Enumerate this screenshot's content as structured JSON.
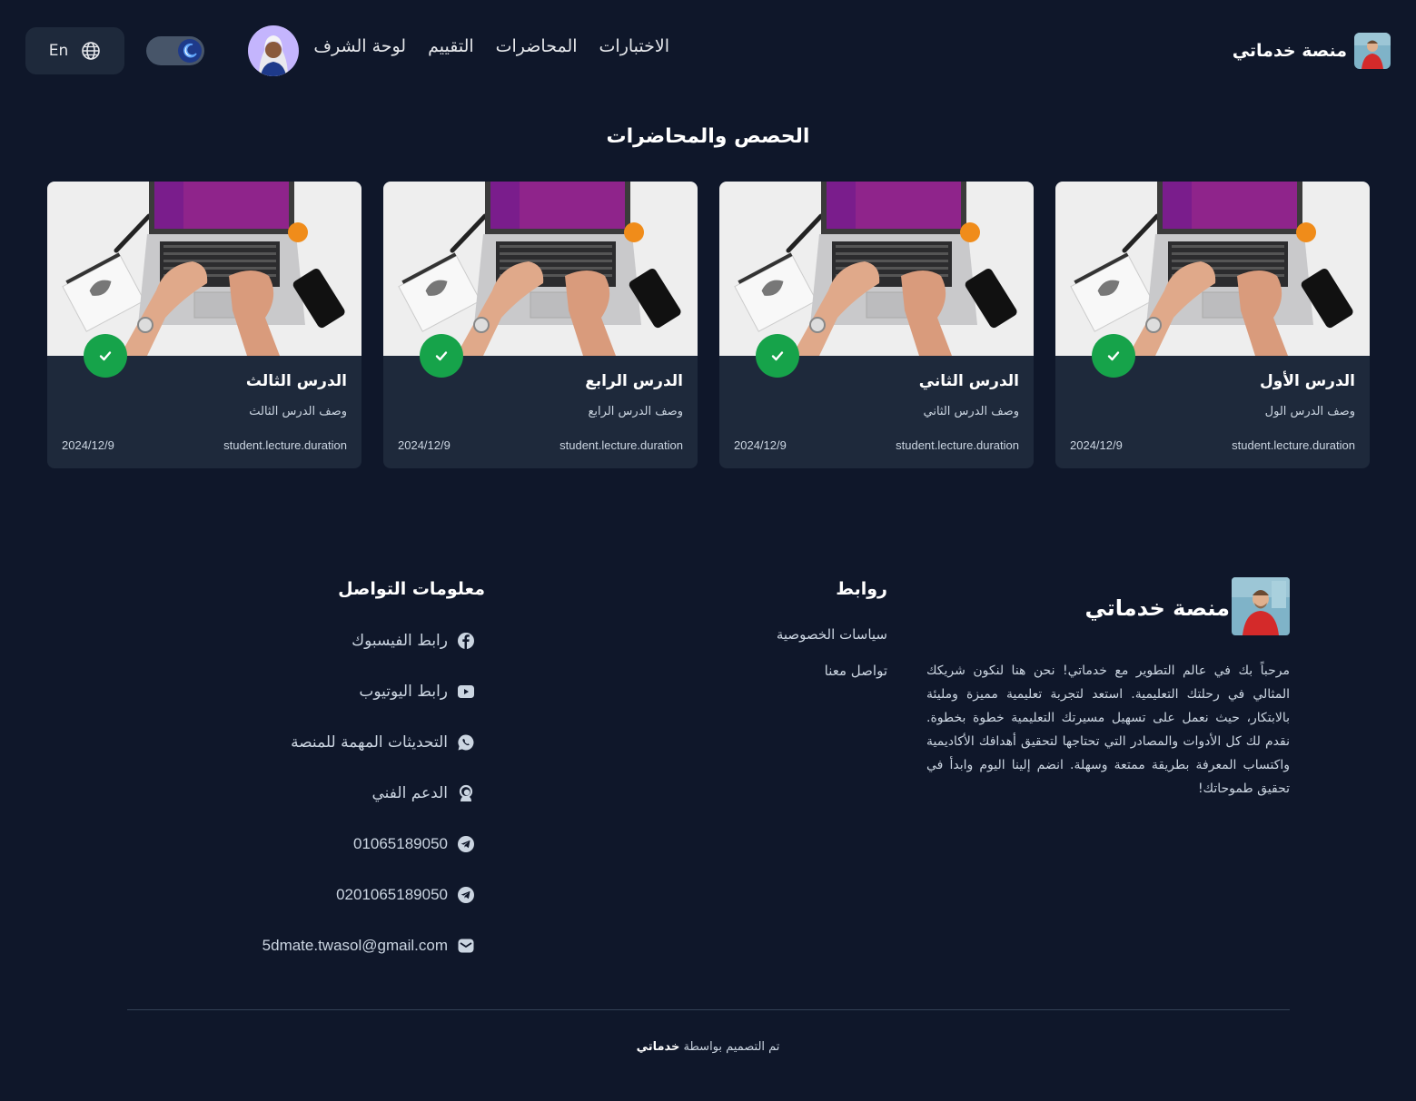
{
  "header": {
    "brand_name": "منصة خدماتي",
    "nav": [
      "الاختبارات",
      "المحاضرات",
      "التقييم",
      "لوحة الشرف"
    ],
    "language_label": "En"
  },
  "lectures": {
    "title": "الحصص والمحاضرات",
    "cards": [
      {
        "title": "الدرس الأول",
        "description": "وصف الدرس الول",
        "duration": "student.lecture.duration",
        "date": "2024/12/9",
        "completed": true
      },
      {
        "title": "الدرس الثاني",
        "description": "وصف الدرس الثاني",
        "duration": "student.lecture.duration",
        "date": "2024/12/9",
        "completed": true
      },
      {
        "title": "الدرس الرابع",
        "description": "وصف الدرس الرابع",
        "duration": "student.lecture.duration",
        "date": "2024/12/9",
        "completed": true
      },
      {
        "title": "الدرس الثالث",
        "description": "وصف الدرس الثالث",
        "duration": "student.lecture.duration",
        "date": "2024/12/9",
        "completed": true
      }
    ]
  },
  "footer": {
    "brand_name": "منصة خدماتي",
    "about": "مرحباً بك في عالم التطوير مع خدماتي! نحن هنا لنكون شريكك المثالي في رحلتك التعليمية. استعد لتجربة تعليمية مميزة ومليئة بالابتكار، حيث نعمل على تسهيل مسيرتك التعليمية خطوة بخطوة. نقدم لك كل الأدوات والمصادر التي تحتاجها لتحقيق أهدافك الأكاديمية واكتساب المعرفة بطريقة ممتعة وسهلة. انضم إلينا اليوم وابدأ في تحقيق طموحاتك!",
    "links_title": "روابط",
    "links": [
      "سياسات الخصوصية",
      "تواصل معنا"
    ],
    "contact_title": "معلومات التواصل",
    "contacts": [
      {
        "icon": "facebook-icon",
        "label": "رابط الفيسبوك"
      },
      {
        "icon": "youtube-icon",
        "label": "رابط اليوتيوب"
      },
      {
        "icon": "whatsapp-icon",
        "label": "التحديثات المهمة للمنصة"
      },
      {
        "icon": "support-icon",
        "label": "الدعم الفني"
      },
      {
        "icon": "telegram-icon",
        "label": "01065189050"
      },
      {
        "icon": "telegram-icon",
        "label": "0201065189050"
      },
      {
        "icon": "mail-icon",
        "label": "5dmate.twasol@gmail.com"
      }
    ],
    "credit_prefix": "تم التصميم بواسطة",
    "credit_name": "خدماتي"
  },
  "colors": {
    "background": "#0f172a",
    "card": "#1e293b",
    "success": "#16a34a"
  }
}
